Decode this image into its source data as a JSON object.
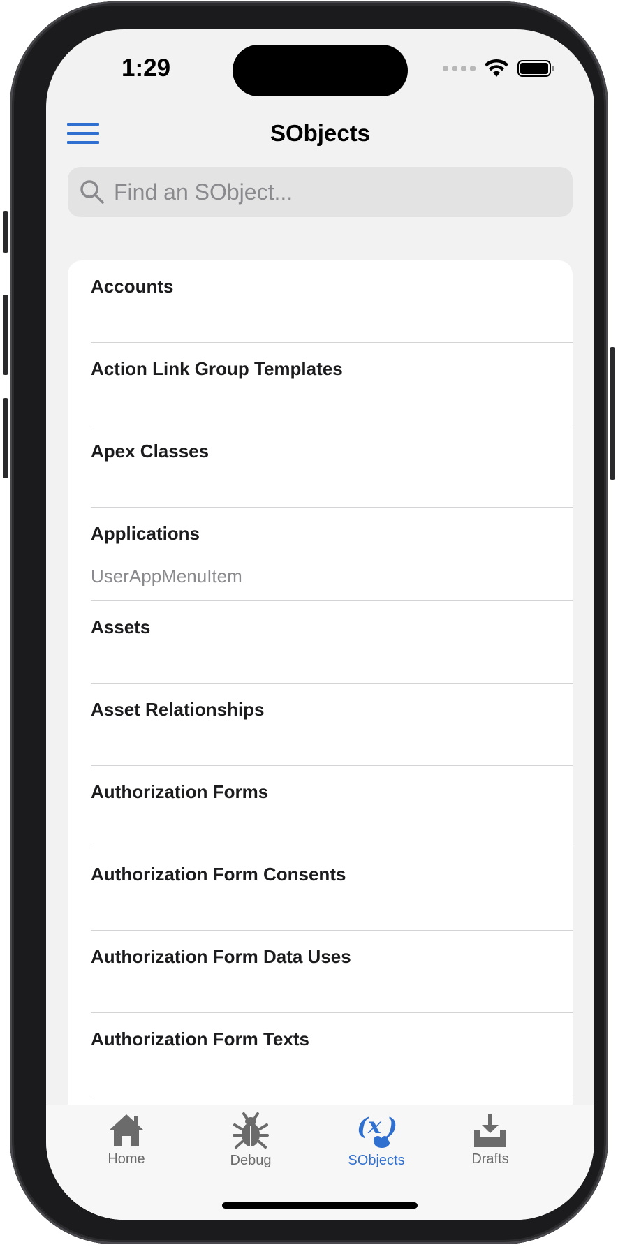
{
  "status": {
    "time": "1:29"
  },
  "nav": {
    "title": "SObjects"
  },
  "search": {
    "placeholder": "Find an SObject..."
  },
  "list": [
    {
      "title": "Accounts",
      "subtitle": ""
    },
    {
      "title": "Action Link Group Templates",
      "subtitle": ""
    },
    {
      "title": "Apex Classes",
      "subtitle": ""
    },
    {
      "title": "Applications",
      "subtitle": "UserAppMenuItem"
    },
    {
      "title": "Assets",
      "subtitle": ""
    },
    {
      "title": "Asset Relationships",
      "subtitle": ""
    },
    {
      "title": "Authorization Forms",
      "subtitle": ""
    },
    {
      "title": "Authorization Form Consents",
      "subtitle": ""
    },
    {
      "title": "Authorization Form Data Uses",
      "subtitle": ""
    },
    {
      "title": "Authorization Form Texts",
      "subtitle": ""
    },
    {
      "title": "",
      "subtitle": ""
    }
  ],
  "tabs": [
    {
      "label": "Home",
      "icon": "house-icon"
    },
    {
      "label": "Debug",
      "icon": "bug-icon"
    },
    {
      "label": "SObjects",
      "icon": "sobject-icon"
    },
    {
      "label": "Drafts",
      "icon": "tray-download-icon"
    }
  ],
  "colors": {
    "accent": "#2f6fd0",
    "inactive_tab": "#6b6b6b",
    "background": "#f2f2f2"
  }
}
